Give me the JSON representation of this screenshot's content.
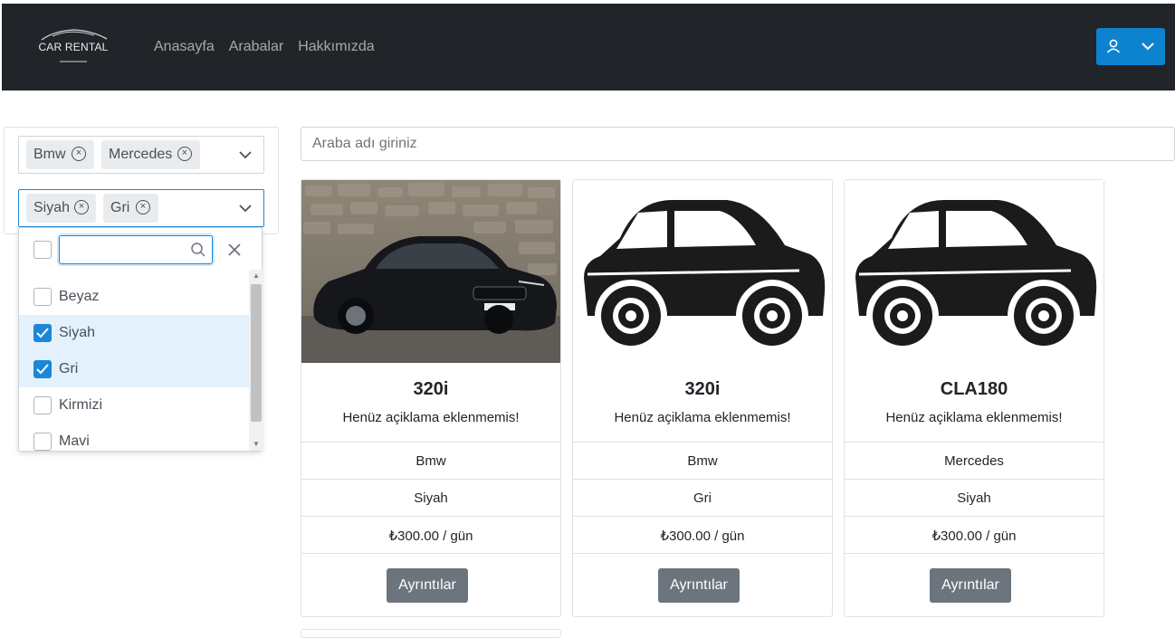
{
  "navbar": {
    "logo_text": "CAR RENTAL",
    "links": [
      "Anasayfa",
      "Arabalar",
      "Hakkımızda"
    ],
    "user_icon": "user-icon",
    "accent": "#0d83d0"
  },
  "filters": {
    "brand": {
      "chips": [
        "Bmw",
        "Mercedes"
      ]
    },
    "color": {
      "chips": [
        "Siyah",
        "Gri"
      ]
    },
    "dropdown": {
      "search_value": "",
      "options": [
        {
          "label": "Beyaz",
          "checked": false
        },
        {
          "label": "Siyah",
          "checked": true
        },
        {
          "label": "Gri",
          "checked": true
        },
        {
          "label": "Kirmizi",
          "checked": false
        },
        {
          "label": "Mavi",
          "checked": false
        }
      ]
    }
  },
  "search": {
    "placeholder": "Araba adı giriniz"
  },
  "cars": [
    {
      "image": "bmw-photo",
      "name": "320i",
      "description": "Henüz açiklama eklenmemis!",
      "brand": "Bmw",
      "color": "Siyah",
      "price": "₺300.00 / gün",
      "button": "Ayrıntılar"
    },
    {
      "image": "car-silhouette",
      "name": "320i",
      "description": "Henüz açiklama eklenmemis!",
      "brand": "Bmw",
      "color": "Gri",
      "price": "₺300.00 / gün",
      "button": "Ayrıntılar"
    },
    {
      "image": "car-silhouette",
      "name": "CLA180",
      "description": "Henüz açiklama eklenmemis!",
      "brand": "Mercedes",
      "color": "Siyah",
      "price": "₺300.00 / gün",
      "button": "Ayrıntılar"
    }
  ]
}
